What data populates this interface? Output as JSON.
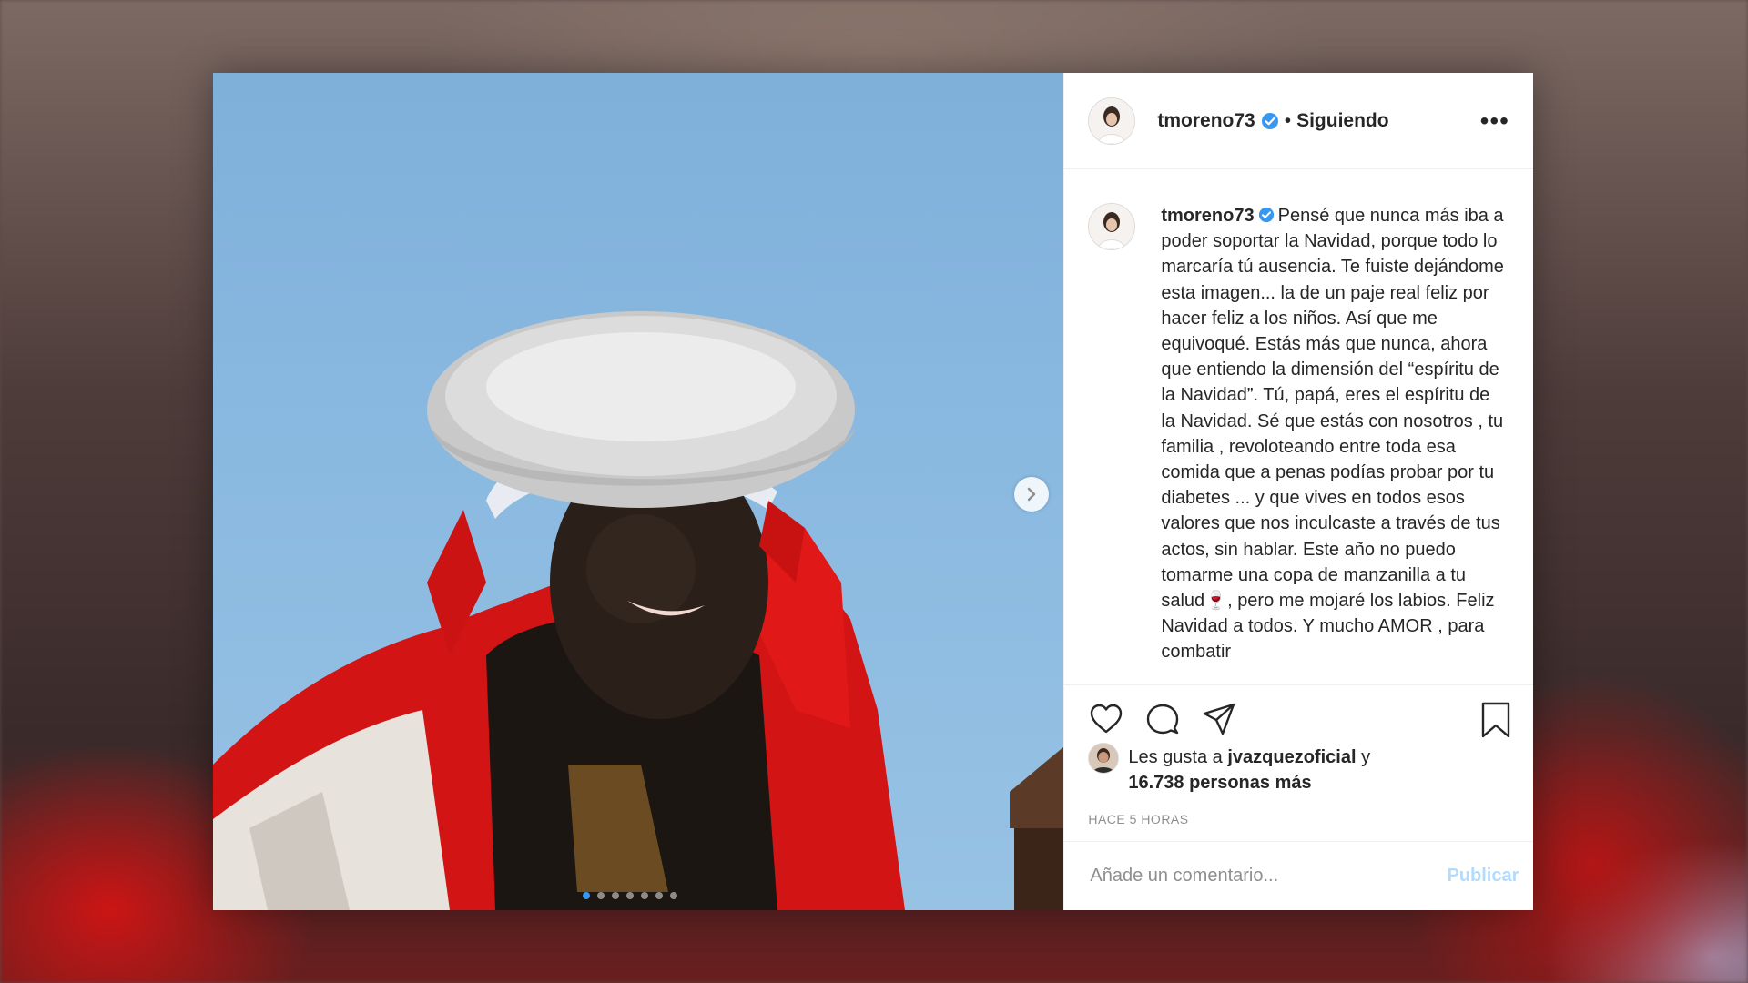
{
  "post": {
    "username": "tmoreno73",
    "separator": "•",
    "follow_status": "Siguiendo",
    "more_label": "•••",
    "caption": "Pensé que nunca más iba a poder soportar la Navidad, porque todo lo marcaría tú ausencia. Te fuiste dejándome esta imagen... la de un paje real feliz por hacer feliz a los niños. Así que me equivoqué. Estás más que nunca, ahora que entiendo la dimensión del “espíritu de la Navidad”. Tú, papá, eres el espíritu de la Navidad. Sé que estás con nosotros , tu familia , revoloteando entre toda esa comida que a penas podías probar por tu diabetes ... y que vives en todos esos valores que nos inculcaste a través de tus actos, sin hablar. Este año no puedo tomarme una copa de manzanilla a tu salud🍷, pero me mojaré los labios. Feliz Navidad a todos. Y mucho AMOR , para combatir",
    "likes_prefix": "Les gusta a",
    "liked_by": "jvazquezoficial",
    "likes_conj": "y",
    "likes_count": "16.738 personas más",
    "timestamp": "HACE 5 HORAS",
    "comment_placeholder": "Añade un comentario...",
    "publish_label": "Publicar",
    "carousel": {
      "total": 7,
      "current": 1
    }
  },
  "colors": {
    "verified": "#3897f0",
    "active_dot": "#3897f0",
    "publish_disabled": "#b3dbff",
    "text": "#262626",
    "muted": "#8e8e8e"
  },
  "icons": [
    "chevron-right-icon",
    "verified-badge-icon",
    "heart-icon",
    "comment-icon",
    "share-icon",
    "bookmark-icon",
    "more-options-icon"
  ]
}
